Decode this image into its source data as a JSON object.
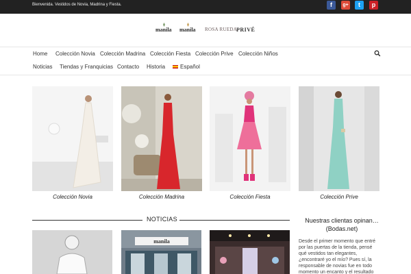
{
  "topbar": {
    "welcome": "Bienvenida. Vestidos de Novia, Madrina y Fiesta.",
    "social": [
      {
        "name": "facebook",
        "glyph": "f",
        "color": "#3b5998"
      },
      {
        "name": "google-plus",
        "glyph": "g+",
        "color": "#dd4b39"
      },
      {
        "name": "twitter",
        "glyph": "t",
        "color": "#1da1f2"
      },
      {
        "name": "pinterest",
        "glyph": "p",
        "color": "#cb2027"
      }
    ]
  },
  "logos": {
    "manila1": "manila",
    "manila2": "manila",
    "rosa_rueda": "ROSA RUEDA",
    "prive": "PRIVÉ"
  },
  "nav": {
    "row1": [
      "Home",
      "Colección Novia",
      "Colección Madrina",
      "Colección Fiesta",
      "Colección Prive",
      "Colección Niños"
    ],
    "row2": [
      "Noticias",
      "Tiendas y Franquicias",
      "Contacto",
      "Historia",
      "Español"
    ]
  },
  "collections": [
    {
      "caption": "Colección Novia",
      "dress_color": "#f1ece4",
      "bg": "#e9e9e9"
    },
    {
      "caption": "Colección Madrina",
      "dress_color": "#d8262c",
      "bg": "#d6d2c8"
    },
    {
      "caption": "Colección Fiesta",
      "dress_color": "#e8578a",
      "bg": "#f0f0f0"
    },
    {
      "caption": "Colección Prive",
      "dress_color": "#8fd1c4",
      "bg": "#e4e4e4"
    }
  ],
  "news_heading": "NOTICIAS",
  "news": [
    {
      "name": "news-image-model",
      "bg": "#d0d0d0"
    },
    {
      "name": "news-image-store",
      "sign": "manila",
      "bg": "#6c7a86"
    },
    {
      "name": "news-image-event",
      "bg": "#3b2a2a"
    }
  ],
  "sidebar": {
    "title": "Nuestras clientas opinan… (Bodas.net)",
    "text": "Desde el primer momento que entré por las puertas de la tienda, pensé qué vestidos tan elegantes, ¿encontraré yo el mío? Pues sí, la responsable de novias fue en todo momento un encanto y el resultado fue espectacular ... mi vestido"
  }
}
